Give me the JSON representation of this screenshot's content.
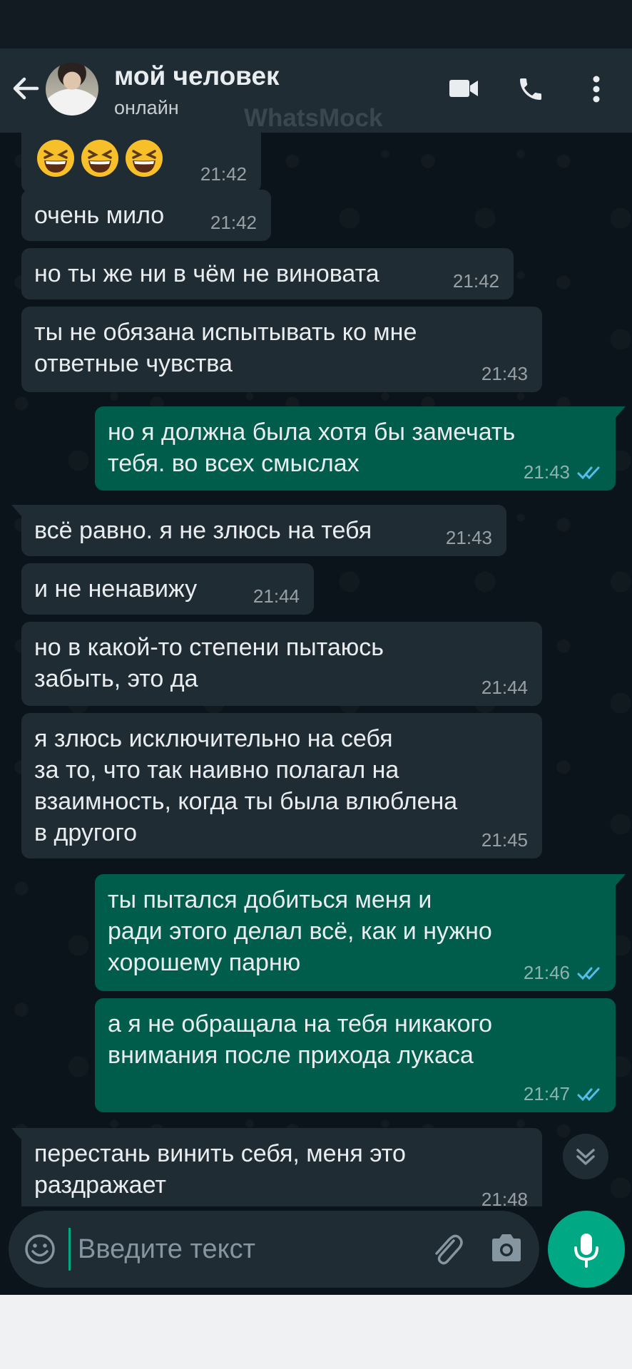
{
  "header": {
    "contact_name": "мой человек",
    "contact_status": "онлайн",
    "watermark": "WhatsMock"
  },
  "messages": [
    {
      "direction": "in",
      "emoji": [
        "grinning-squinting-face",
        "grinning-squinting-face",
        "grinning-squinting-face"
      ],
      "text": "",
      "time": "21:42"
    },
    {
      "direction": "in",
      "text": "очень мило",
      "time": "21:42"
    },
    {
      "direction": "in",
      "text": "но ты же ни в чём не виновата",
      "time": "21:42"
    },
    {
      "direction": "in",
      "text": "ты не обязана испытывать ко мне\nответные чувства",
      "time": "21:43"
    },
    {
      "direction": "out",
      "text": "но я должна была хотя бы замечать\nтебя. во всех смыслах",
      "time": "21:43",
      "read": true
    },
    {
      "direction": "in",
      "text": "всё равно. я не злюсь на тебя",
      "time": "21:43"
    },
    {
      "direction": "in",
      "text": "и не ненавижу",
      "time": "21:44"
    },
    {
      "direction": "in",
      "text": "но в какой-то степени пытаюсь\nзабыть, это да",
      "time": "21:44"
    },
    {
      "direction": "in",
      "text": "я злюсь исключительно на себя\nза то, что так наивно полагал на\nвзаимность, когда ты была влюблена\nв другого",
      "time": "21:45"
    },
    {
      "direction": "out",
      "text": "ты пытался добиться меня и\nради этого делал всё, как и нужно\nхорошему парню",
      "time": "21:46",
      "read": true
    },
    {
      "direction": "out",
      "text": "а я не обращала на тебя никакого\nвнимания после прихода лукаса",
      "time": "21:47",
      "read": true
    },
    {
      "direction": "in",
      "text": "перестань винить себя, меня это\nраздражает",
      "time": "21:48"
    }
  ],
  "input": {
    "placeholder": "Введите текст",
    "value": ""
  },
  "colors": {
    "header_bg": "#1f2c34",
    "chat_bg": "#0b141a",
    "incoming_bubble": "#202c33",
    "outgoing_bubble": "#005c4b",
    "accent": "#00a884",
    "read_ticks": "#53bdeb"
  },
  "icons": {
    "back": "arrow-left-icon",
    "video": "video-camera-icon",
    "call": "phone-icon",
    "menu": "more-vertical-icon",
    "emoji": "smiley-icon",
    "attach": "paperclip-icon",
    "camera": "camera-icon",
    "mic": "microphone-icon",
    "scroll": "chevron-double-down-icon"
  }
}
